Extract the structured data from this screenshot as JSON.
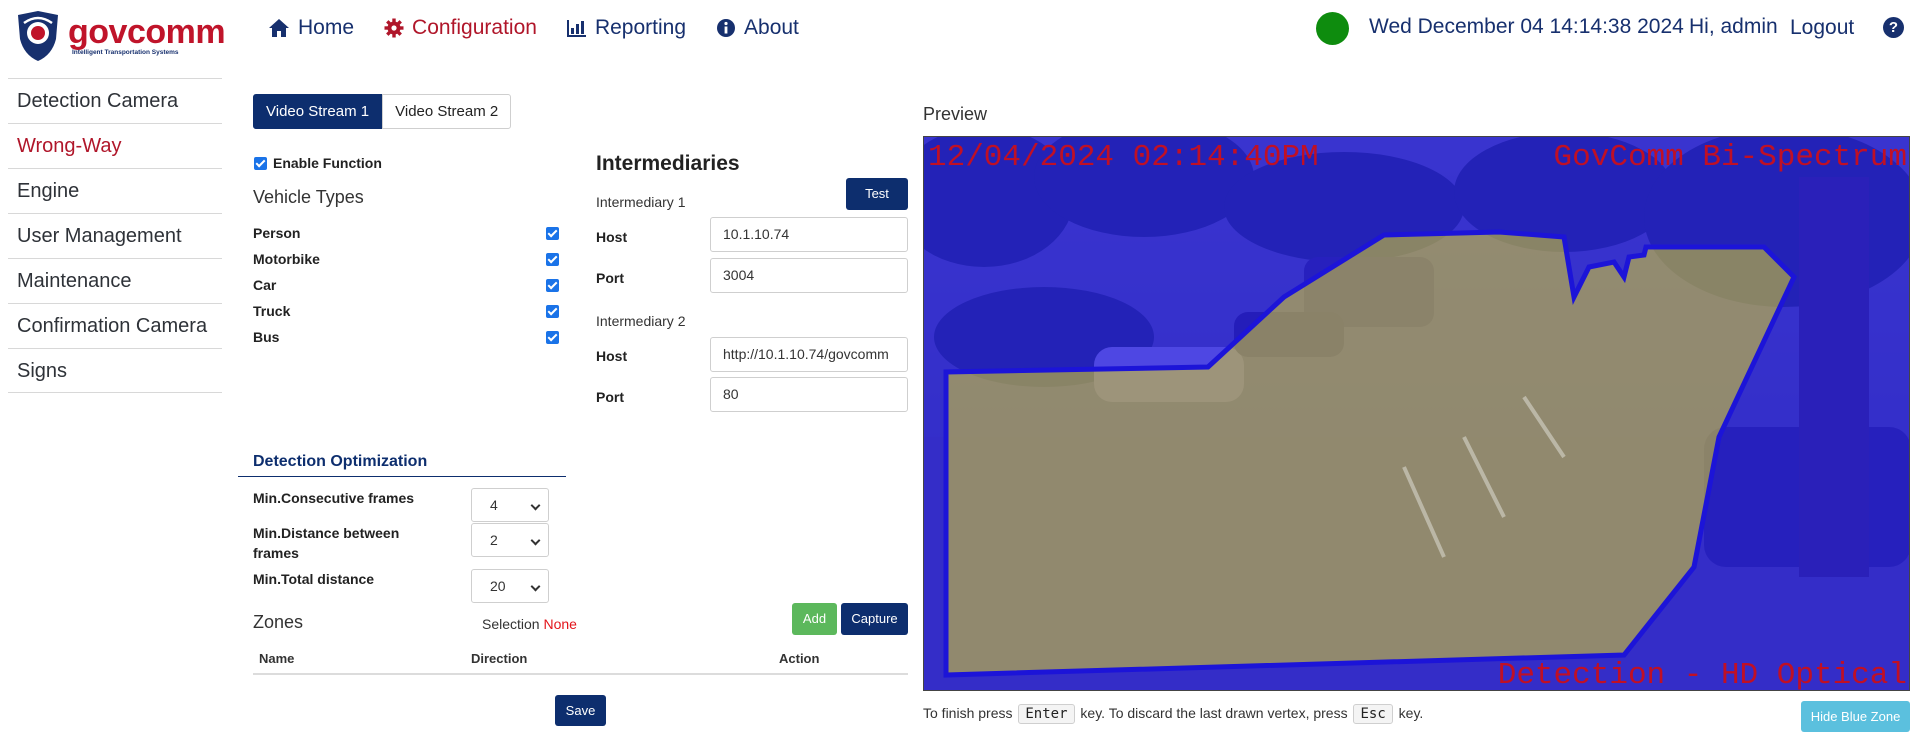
{
  "brand": {
    "name": "govcomm",
    "tagline": "Intelligent Transportation Systems"
  },
  "nav": [
    {
      "label": "Home",
      "icon": "home-icon"
    },
    {
      "label": "Configuration",
      "icon": "gear-icon",
      "active": true
    },
    {
      "label": "Reporting",
      "icon": "chart-icon"
    },
    {
      "label": "About",
      "icon": "info-icon"
    }
  ],
  "header": {
    "status_color": "#0e8c0e",
    "datetime": "Wed December 04 14:14:38 2024",
    "greeting": "Hi, admin",
    "logout": "Logout",
    "help": "?"
  },
  "sidebar": {
    "items": [
      {
        "label": "Detection Camera"
      },
      {
        "label": "Wrong-Way",
        "active": true
      },
      {
        "label": "Engine"
      },
      {
        "label": "User Management"
      },
      {
        "label": "Maintenance"
      },
      {
        "label": "Confirmation Camera"
      },
      {
        "label": "Signs"
      }
    ]
  },
  "streams": {
    "tab1": "Video Stream 1",
    "tab2": "Video Stream 2"
  },
  "function": {
    "enable_label": "Enable Function",
    "enabled": true
  },
  "vehicle_types": {
    "title": "Vehicle Types",
    "items": [
      {
        "label": "Person",
        "checked": true
      },
      {
        "label": "Motorbike",
        "checked": true
      },
      {
        "label": "Car",
        "checked": true
      },
      {
        "label": "Truck",
        "checked": true
      },
      {
        "label": "Bus",
        "checked": true
      }
    ]
  },
  "intermediaries": {
    "title": "Intermediaries",
    "test_label": "Test",
    "host_label": "Host",
    "port_label": "Port",
    "i1": {
      "label": "Intermediary 1",
      "host": "10.1.10.74",
      "port": "3004"
    },
    "i2": {
      "label": "Intermediary 2",
      "host": "http://10.1.10.74/govcomm",
      "port": "80"
    }
  },
  "optimization": {
    "title": "Detection Optimization",
    "consecutive": {
      "label": "Min.Consecutive frames",
      "value": "4"
    },
    "distance": {
      "label": "Min.Distance between frames",
      "value": "2"
    },
    "total": {
      "label": "Min.Total distance",
      "value": "20"
    }
  },
  "zones": {
    "title": "Zones",
    "selection_label": "Selection",
    "selection_value": "None",
    "add_label": "Add",
    "capture_label": "Capture",
    "columns": {
      "name": "Name",
      "direction": "Direction",
      "action": "Action"
    },
    "rows": []
  },
  "save_label": "Save",
  "preview": {
    "title": "Preview",
    "overlay_timestamp": "12/04/2024 02:14:40PM",
    "overlay_title": "GovComm Bi-Spectrum",
    "overlay_footer": "Detection - HD Optical",
    "hint_before": "To finish press",
    "key_enter": "Enter",
    "hint_middle": "key. To discard the last drawn vertex, press",
    "key_esc": "Esc",
    "hint_after": "key.",
    "hide_label": "Hide Blue Zone"
  }
}
